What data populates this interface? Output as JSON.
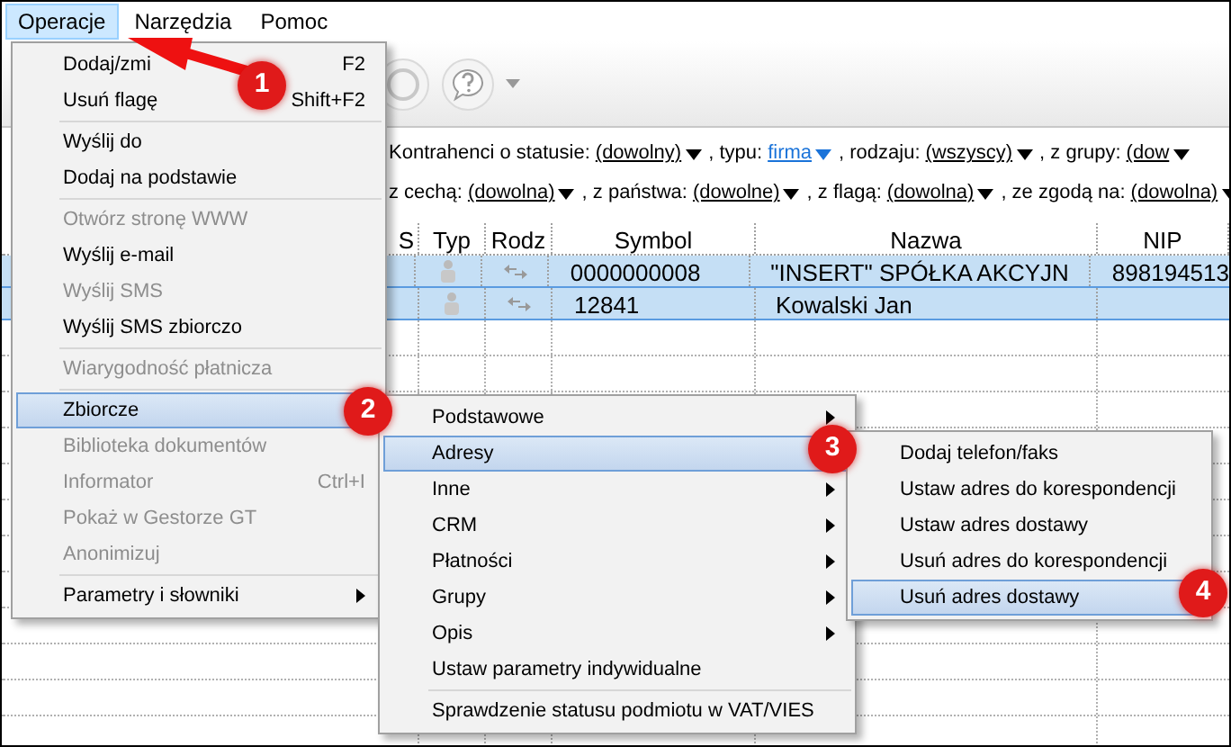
{
  "menubar": [
    {
      "label": "Operacje",
      "selected": true
    },
    {
      "label": "Narzędzia",
      "selected": false
    },
    {
      "label": "Pomoc",
      "selected": false
    }
  ],
  "filters": [
    [
      {
        "kind": "text",
        "label": "Kontrahenci o statusie:"
      },
      {
        "kind": "dropdown",
        "label": "(dowolny)"
      },
      {
        "kind": "text",
        "label": ", typu:"
      },
      {
        "kind": "link",
        "label": "firma"
      },
      {
        "kind": "text",
        "label": ", rodzaju:"
      },
      {
        "kind": "dropdown",
        "label": "(wszyscy)"
      },
      {
        "kind": "text",
        "label": ", z grupy:"
      },
      {
        "kind": "dropdown",
        "label": "(dow"
      }
    ],
    [
      {
        "kind": "text",
        "label": "z cechą:"
      },
      {
        "kind": "dropdown",
        "label": "(dowolna)"
      },
      {
        "kind": "text",
        "label": ", z państwa:"
      },
      {
        "kind": "dropdown",
        "label": "(dowolne)"
      },
      {
        "kind": "text",
        "label": ", z flagą:"
      },
      {
        "kind": "dropdown",
        "label": "(dowolna)"
      },
      {
        "kind": "text",
        "label": ", ze zgodą na:"
      },
      {
        "kind": "dropdown",
        "label": "(dowolna)"
      }
    ]
  ],
  "table": {
    "columns": [
      "S",
      "Typ",
      "Rodz",
      "Symbol",
      "Nazwa",
      "NIP"
    ],
    "rows": [
      {
        "selected": true,
        "symbol": "0000000008",
        "nazwa": "\"INSERT\" SPÓŁKA AKCYJN",
        "nip": "898194513"
      },
      {
        "selected": true,
        "symbol": "12841",
        "nazwa": "Kowalski Jan",
        "nip": ""
      }
    ]
  },
  "menu": [
    {
      "kind": "item",
      "label": "Dodaj/zmi",
      "shortcut": "F2",
      "disabled": false,
      "selected": false
    },
    {
      "kind": "item",
      "label": "Usuń flagę",
      "shortcut": "Shift+F2",
      "disabled": false,
      "selected": false
    },
    {
      "kind": "separator"
    },
    {
      "kind": "item",
      "label": "Wyślij do",
      "disabled": false,
      "selected": false
    },
    {
      "kind": "item",
      "label": "Dodaj na podstawie",
      "disabled": false,
      "selected": false
    },
    {
      "kind": "separator"
    },
    {
      "kind": "item",
      "label": "Otwórz stronę WWW",
      "disabled": true,
      "selected": false
    },
    {
      "kind": "item",
      "label": "Wyślij e-mail",
      "disabled": false,
      "selected": false
    },
    {
      "kind": "item",
      "label": "Wyślij SMS",
      "disabled": true,
      "selected": false
    },
    {
      "kind": "item",
      "label": "Wyślij SMS zbiorczo",
      "disabled": false,
      "selected": false
    },
    {
      "kind": "separator"
    },
    {
      "kind": "item",
      "label": "Wiarygodność płatnicza",
      "disabled": true,
      "selected": false
    },
    {
      "kind": "separator"
    },
    {
      "kind": "item",
      "label": "Zbiorcze",
      "disabled": false,
      "selected": true
    },
    {
      "kind": "item",
      "label": "Biblioteka dokumentów",
      "disabled": true,
      "selected": false
    },
    {
      "kind": "item",
      "label": "Informator",
      "shortcut": "Ctrl+I",
      "disabled": true,
      "selected": false
    },
    {
      "kind": "item",
      "label": "Pokaż w Gestorze GT",
      "disabled": true,
      "selected": false
    },
    {
      "kind": "item",
      "label": "Anonimizuj",
      "disabled": true,
      "selected": false
    },
    {
      "kind": "separator"
    },
    {
      "kind": "submenu",
      "label": "Parametry i słowniki",
      "disabled": false,
      "selected": false
    }
  ],
  "submenu": [
    {
      "kind": "submenu",
      "label": "Podstawowe",
      "disabled": false,
      "selected": false
    },
    {
      "kind": "item",
      "label": "Adresy",
      "disabled": false,
      "selected": true
    },
    {
      "kind": "submenu",
      "label": "Inne",
      "disabled": false,
      "selected": false
    },
    {
      "kind": "submenu",
      "label": "CRM",
      "disabled": false,
      "selected": false
    },
    {
      "kind": "submenu",
      "label": "Płatności",
      "disabled": false,
      "selected": false
    },
    {
      "kind": "submenu",
      "label": "Grupy",
      "disabled": false,
      "selected": false
    },
    {
      "kind": "submenu",
      "label": "Opis",
      "disabled": false,
      "selected": false
    },
    {
      "kind": "item",
      "label": "Ustaw parametry indywidualne",
      "disabled": false,
      "selected": false
    },
    {
      "kind": "separator"
    },
    {
      "kind": "item",
      "label": "Sprawdzenie statusu podmiotu w VAT/VIES",
      "disabled": false,
      "selected": false
    }
  ],
  "submenu_2": [
    {
      "kind": "item",
      "label": "Dodaj telefon/faks",
      "disabled": false,
      "selected": false
    },
    {
      "kind": "item",
      "label": "Ustaw adres do korespondencji",
      "disabled": false,
      "selected": false
    },
    {
      "kind": "item",
      "label": "Ustaw adres dostawy",
      "disabled": false,
      "selected": false
    },
    {
      "kind": "item",
      "label": "Usuń adres do korespondencji",
      "disabled": false,
      "selected": false
    },
    {
      "kind": "item",
      "label": "Usuń adres dostawy",
      "disabled": false,
      "selected": true
    }
  ],
  "step_badges": [
    "1",
    "2",
    "3",
    "4"
  ]
}
